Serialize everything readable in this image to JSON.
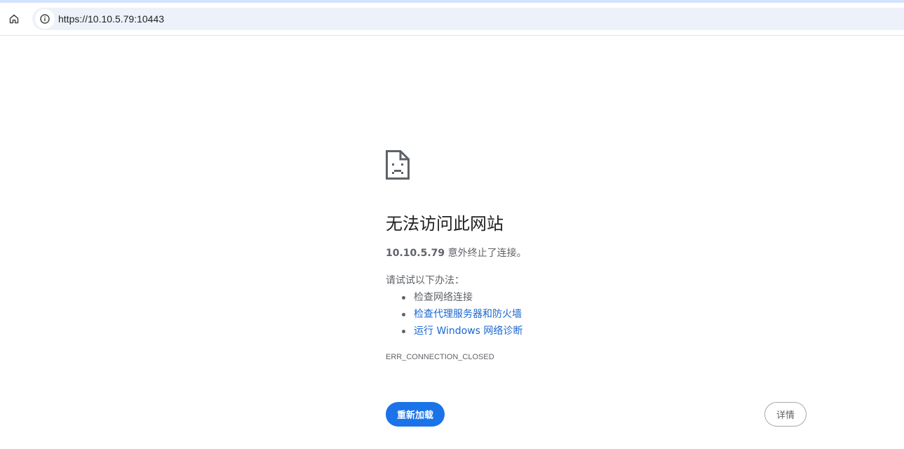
{
  "browser": {
    "url": "https://10.10.5.79:10443",
    "icons": {
      "home": "home-icon",
      "site_info": "info-icon"
    }
  },
  "error_page": {
    "icon": "sad-page-icon",
    "title": "无法访问此网站",
    "host": "10.10.5.79",
    "message": " 意外终止了连接。",
    "try_label": "请试试以下办法：",
    "suggestions": [
      "检查网络连接",
      "检查代理服务器和防火墙",
      "运行 Windows 网络诊断"
    ],
    "error_code": "ERR_CONNECTION_CLOSED",
    "reload_label": "重新加载",
    "details_label": "详情"
  },
  "colors": {
    "accent": "#1a73e8",
    "link": "#1967d2",
    "text_secondary": "#5f6368",
    "omnibox_bg": "#edf2fa"
  }
}
